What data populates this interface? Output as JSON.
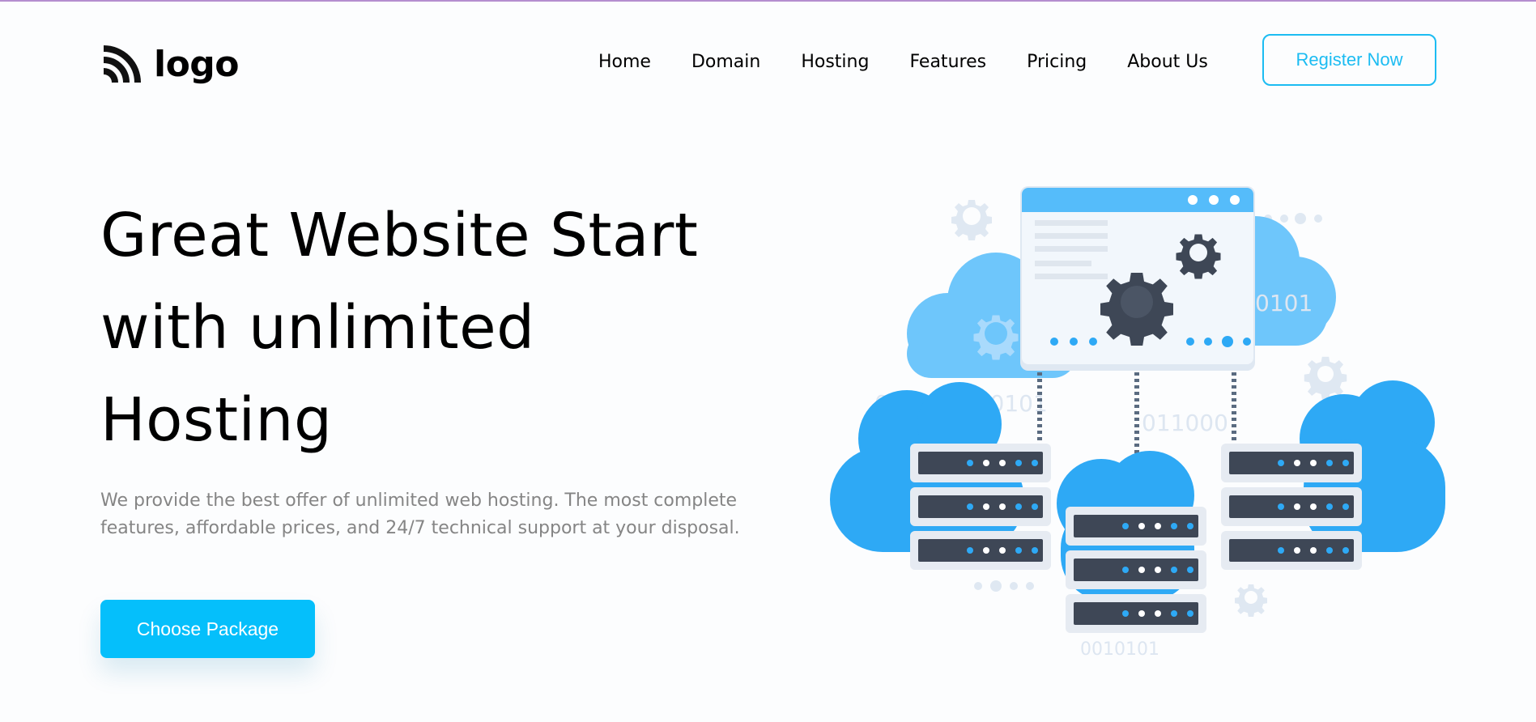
{
  "header": {
    "logo_text": "logo",
    "nav": [
      "Home",
      "Domain",
      "Hosting",
      "Features",
      "Pricing",
      "About Us"
    ],
    "register_label": "Register Now"
  },
  "hero": {
    "title_lines": [
      "Great Website Start",
      "with unlimited",
      "Hosting"
    ],
    "description": "We provide the best offer of unlimited web hosting. The most complete features, affordable prices, and 24/7 technical support at your disposal.",
    "cta_label": "Choose Package"
  },
  "illustration": {
    "binary_texts": [
      "0101",
      "001011000101",
      "011000",
      "0010101"
    ]
  },
  "colors": {
    "accent": "#1cbcf2",
    "cta": "#05bffb",
    "cloud_light": "#6ec6fb",
    "cloud": "#2ea9f5",
    "server_dark": "#3e4756",
    "gear_light": "#dfe8f2"
  },
  "icons": [
    "logo-signal-icon",
    "gear-icon",
    "server-rack-icon",
    "cloud-icon",
    "browser-window-icon"
  ]
}
